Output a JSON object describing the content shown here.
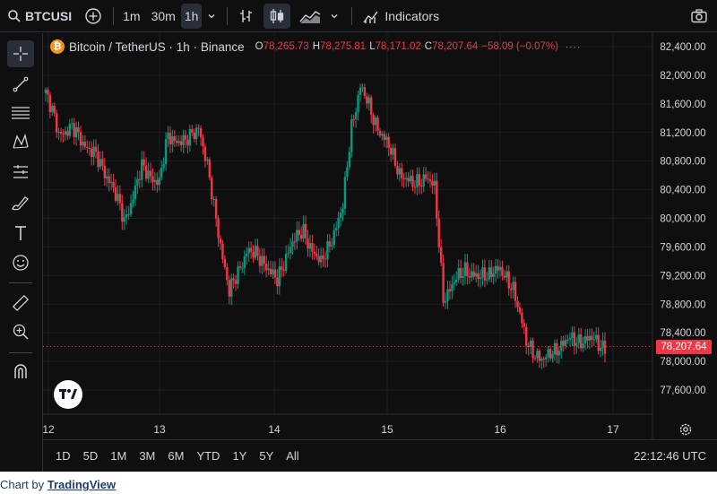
{
  "toolbar": {
    "symbol": "BTCUSI",
    "intervals": [
      "1m",
      "30m",
      "1h"
    ],
    "active_interval": "1h",
    "indicators_label": "Indicators"
  },
  "legend": {
    "title": "Bitcoin / TetherUS · 1h · Binance",
    "open_key": "O",
    "open": "78,265.73",
    "high_key": "H",
    "high": "78,275.81",
    "low_key": "L",
    "low": "78,171.02",
    "close_key": "C",
    "close": "78,207.64",
    "change": "−58.09 (−0.07%)"
  },
  "colors": {
    "up": "#089981",
    "down": "#f23645",
    "background": "#0f0f0f",
    "text": "#d1d4dc",
    "grid": "#1c1f26"
  },
  "icons": [
    "search-icon",
    "add-compare-icon",
    "chevron-down-icon",
    "bar-style-icon",
    "candle-style-icon",
    "area-style-icon",
    "indicators-icon",
    "camera-icon",
    "crosshair-icon",
    "trend-line-icon",
    "fib-icon",
    "pattern-icon",
    "forecast-icon",
    "brush-icon",
    "text-icon",
    "emoji-icon",
    "ruler-icon",
    "zoom-icon",
    "magnet-icon",
    "tradingview-logo-icon",
    "settings-icon"
  ],
  "chart_data": {
    "type": "candlestick",
    "ylim": [
      77300,
      82500
    ],
    "y_ticks": [
      "82,400.00",
      "82,000.00",
      "81,600.00",
      "81,200.00",
      "80,800.00",
      "80,400.00",
      "80,000.00",
      "79,600.00",
      "79,200.00",
      "78,800.00",
      "78,400.00",
      "78,000.00",
      "77,600.00"
    ],
    "y_tick_values": [
      82400,
      82000,
      81600,
      81200,
      80800,
      80400,
      80000,
      79600,
      79200,
      78800,
      78400,
      78000,
      77600
    ],
    "x_ticks": [
      "12",
      "13",
      "14",
      "15",
      "16",
      "17"
    ],
    "last_price": "78,207.64",
    "last_price_value": 78207.64,
    "start_close": 81750
  },
  "bottom": {
    "ranges": [
      "1D",
      "5D",
      "1M",
      "3M",
      "6M",
      "YTD",
      "1Y",
      "5Y",
      "All"
    ],
    "clock": "22:12:46 UTC"
  },
  "attribution": {
    "prefix": "Chart by",
    "link": "TradingView"
  }
}
